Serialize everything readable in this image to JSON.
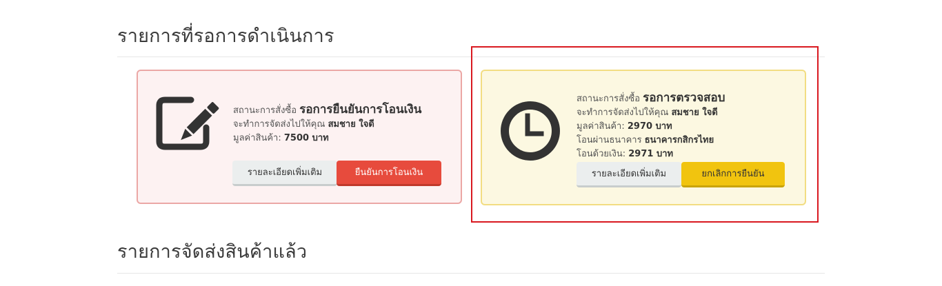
{
  "sections": {
    "pending_title": "รายการที่รอการดำเนินการ",
    "shipped_title": "รายการจัดส่งสินค้าแล้ว"
  },
  "orders": [
    {
      "icon": "edit-icon",
      "status_label": "สถานะการสั่งซื้อ",
      "status_value": "รอการยืนยันการโอนเงิน",
      "ship_to_label": "จะทำการจัดส่งไปให้คุณ",
      "ship_to_name": "สมชาย ใจดี",
      "price_label": "มูลค่าสินค้า:",
      "price_value": "7500 บาท",
      "detail_button": "รายละเอียดเพิ่มเติม",
      "action_button": "ยืนยันการโอนเงิน",
      "colors": {
        "background": "#fdf2f2",
        "border": "#eba7a5",
        "action": "#e74b3d"
      }
    },
    {
      "icon": "clock-icon",
      "status_label": "สถานะการสั่งซื้อ",
      "status_value": "รอการตรวจสอบ",
      "ship_to_label": "จะทำการจัดส่งไปให้คุณ",
      "ship_to_name": "สมชาย ใจดี",
      "price_label": "มูลค่าสินค้า:",
      "price_value": "2970 บาท",
      "bank_label": "โอนผ่านธนาคาร",
      "bank_value": "ธนาคารกสิกรไทย",
      "transfer_label": "โอนด้วยเงิน:",
      "transfer_value": "2971 บาท",
      "detail_button": "รายละเอียดเพิ่มเติม",
      "action_button": "ยกเลิกการยืนยัน",
      "colors": {
        "background": "#fcf8e1",
        "border": "#f2dd82",
        "action": "#f1c40f"
      }
    }
  ],
  "highlight_color": "#d9181f"
}
